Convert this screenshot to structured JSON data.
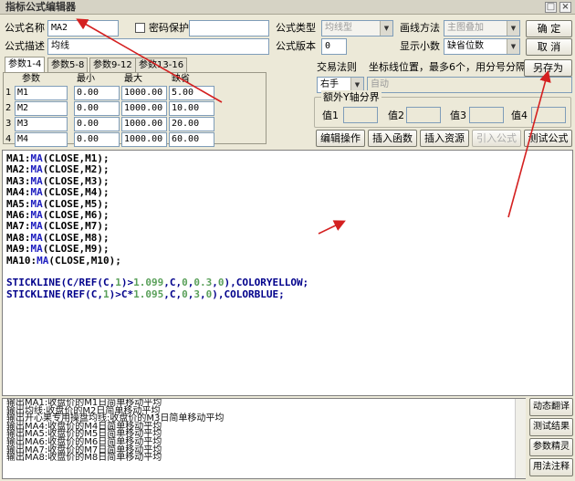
{
  "window": {
    "title": "指标公式编辑器"
  },
  "header": {
    "name_label": "公式名称",
    "name_value": "MA2",
    "password_label": "密码保护",
    "desc_label": "公式描述",
    "desc_value": "均线",
    "type_label": "公式类型",
    "type_value": "均线型",
    "draw_label": "画线方法",
    "draw_value": "主图叠加",
    "version_label": "公式版本",
    "version_value": "0",
    "decimals_label": "显示小数",
    "decimals_value": "缺省位数",
    "trade_rule_label": "交易法则",
    "trade_rule_value": "右手",
    "trade_rule_auto": "自动",
    "coord_text": "坐标线位置，最多6个，用分号分隔",
    "yaxis_group": "额外Y轴分界",
    "value_labels": [
      "值1",
      "值2",
      "值3",
      "值4"
    ]
  },
  "buttons": {
    "ok": "确  定",
    "cancel": "取  消",
    "save_as": "另存为",
    "edit_ops": "编辑操作",
    "insert_fn": "插入函数",
    "insert_res": "插入资源",
    "import_fml": "引入公式",
    "test_fml": "测试公式"
  },
  "tabs": [
    "参数1-4",
    "参数5-8",
    "参数9-12",
    "参数13-16"
  ],
  "params": {
    "headers": [
      "参数",
      "最小",
      "最大",
      "缺省"
    ],
    "rows": [
      {
        "no": "1",
        "name": "M1",
        "min": "0.00",
        "max": "1000.00",
        "def": "5.00"
      },
      {
        "no": "2",
        "name": "M2",
        "min": "0.00",
        "max": "1000.00",
        "def": "10.00"
      },
      {
        "no": "3",
        "name": "M3",
        "min": "0.00",
        "max": "1000.00",
        "def": "20.00"
      },
      {
        "no": "4",
        "name": "M4",
        "min": "0.00",
        "max": "1000.00",
        "def": "60.00"
      }
    ]
  },
  "code_lines": [
    [
      [
        "v",
        "MA1:"
      ],
      [
        "fn",
        "MA"
      ],
      [
        "v",
        "(CLOSE,M1);"
      ]
    ],
    [
      [
        "v",
        "MA2:"
      ],
      [
        "fn",
        "MA"
      ],
      [
        "v",
        "(CLOSE,M2);"
      ]
    ],
    [
      [
        "v",
        "MA3:"
      ],
      [
        "fn",
        "MA"
      ],
      [
        "v",
        "(CLOSE,M3);"
      ]
    ],
    [
      [
        "v",
        "MA4:"
      ],
      [
        "fn",
        "MA"
      ],
      [
        "v",
        "(CLOSE,M4);"
      ]
    ],
    [
      [
        "v",
        "MA5:"
      ],
      [
        "fn",
        "MA"
      ],
      [
        "v",
        "(CLOSE,M5);"
      ]
    ],
    [
      [
        "v",
        "MA6:"
      ],
      [
        "fn",
        "MA"
      ],
      [
        "v",
        "(CLOSE,M6);"
      ]
    ],
    [
      [
        "v",
        "MA7:"
      ],
      [
        "fn",
        "MA"
      ],
      [
        "v",
        "(CLOSE,M7);"
      ]
    ],
    [
      [
        "v",
        "MA8:"
      ],
      [
        "fn",
        "MA"
      ],
      [
        "v",
        "(CLOSE,M8);"
      ]
    ],
    [
      [
        "v",
        "MA9:"
      ],
      [
        "fn",
        "MA"
      ],
      [
        "v",
        "(CLOSE,M9);"
      ]
    ],
    [
      [
        "v",
        "MA10:"
      ],
      [
        "fn",
        "MA"
      ],
      [
        "v",
        "(CLOSE,M10);"
      ]
    ],
    [],
    [
      [
        "pp",
        "STICKLINE(C/REF(C,"
      ],
      [
        "nm",
        "1"
      ],
      [
        "pp",
        ")>"
      ],
      [
        "nm",
        "1.099"
      ],
      [
        "pp",
        ",C,"
      ],
      [
        "nm",
        "0"
      ],
      [
        "pp",
        ","
      ],
      [
        "nm",
        "0.3"
      ],
      [
        "pp",
        ","
      ],
      [
        "nm",
        "0"
      ],
      [
        "pp",
        "),COLORYELLOW;"
      ]
    ],
    [
      [
        "pp",
        "STICKLINE(REF(C,"
      ],
      [
        "nm",
        "1"
      ],
      [
        "pp",
        ")>C*"
      ],
      [
        "nm",
        "1.095"
      ],
      [
        "pp",
        ",C,"
      ],
      [
        "nm",
        "0"
      ],
      [
        "pp",
        ","
      ],
      [
        "nm",
        "3"
      ],
      [
        "pp",
        ","
      ],
      [
        "nm",
        "0"
      ],
      [
        "pp",
        "),COLORBLUE;"
      ]
    ]
  ],
  "output_lines": [
    "输出MA1:收盘价的M1日简单移动平均",
    "输出均线:收盘价的M2日简单移动平均",
    "输出开心果专用操盘均线:收盘价的M3日简单移动平均",
    "输出MA4:收盘价的M4日简单移动平均",
    "输出MA5:收盘价的M5日简单移动平均",
    "输出MA6:收盘价的M6日简单移动平均",
    "输出MA7:收盘价的M7日简单移动平均",
    "输出MA8:收盘价的M8日简单移动平均"
  ],
  "side_buttons": [
    "动态翻译",
    "测试结果",
    "参数精灵",
    "用法注释"
  ],
  "colors": {
    "annotation_arrow": "#d42020",
    "function": "#2020c0",
    "number": "#5aa05a"
  }
}
